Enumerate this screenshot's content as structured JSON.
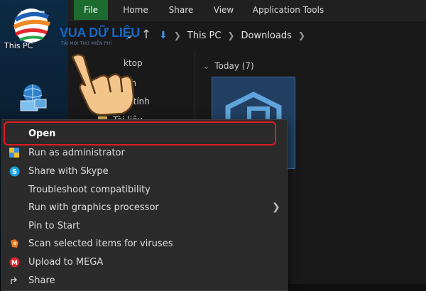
{
  "window": {
    "ribbon_tabs": [
      {
        "label": "File",
        "active": true
      },
      {
        "label": "Home"
      },
      {
        "label": "Share"
      },
      {
        "label": "View"
      },
      {
        "label": "Application Tools"
      }
    ]
  },
  "address": {
    "crumbs": [
      "This PC",
      "Downloads"
    ]
  },
  "desktop": {
    "icons": [
      {
        "name": "this-pc",
        "label": "This PC"
      },
      {
        "name": "network",
        "label": ""
      }
    ]
  },
  "navpane": {
    "items": [
      {
        "label": "ktop"
      },
      {
        "label": "n ảnh"
      },
      {
        "label": "Máy tính"
      },
      {
        "label": "Tài liệu"
      }
    ]
  },
  "filepane": {
    "group_header": "Today (7)"
  },
  "context_menu": {
    "items": [
      {
        "label": "Open",
        "icon": "none",
        "highlighted": true
      },
      {
        "label": "Run as administrator",
        "icon": "shield-icon"
      },
      {
        "label": "Share with Skype",
        "icon": "skype-icon"
      },
      {
        "label": "Troubleshoot compatibility",
        "icon": "none"
      },
      {
        "label": "Run with graphics processor",
        "icon": "none",
        "has_submenu": true
      },
      {
        "label": "Pin to Start",
        "icon": "none"
      },
      {
        "label": "Scan selected items for viruses",
        "icon": "antivirus-icon"
      },
      {
        "label": "Upload to MEGA",
        "icon": "mega-icon"
      },
      {
        "label": "Share",
        "icon": "share-icon"
      }
    ],
    "colors": {
      "highlight_border": "#e01b24",
      "background": "#2b2b2b"
    }
  },
  "overlay": {
    "logo_text": "VUA DỮ LIỆU",
    "logo_subtext": "TẢI MỌI THỨ MIỄN PHÍ",
    "pointer": "hand-pointer-icon"
  },
  "colors": {
    "ribbon_active": "#1c6b2f",
    "logo_blue": "#1467c6"
  }
}
